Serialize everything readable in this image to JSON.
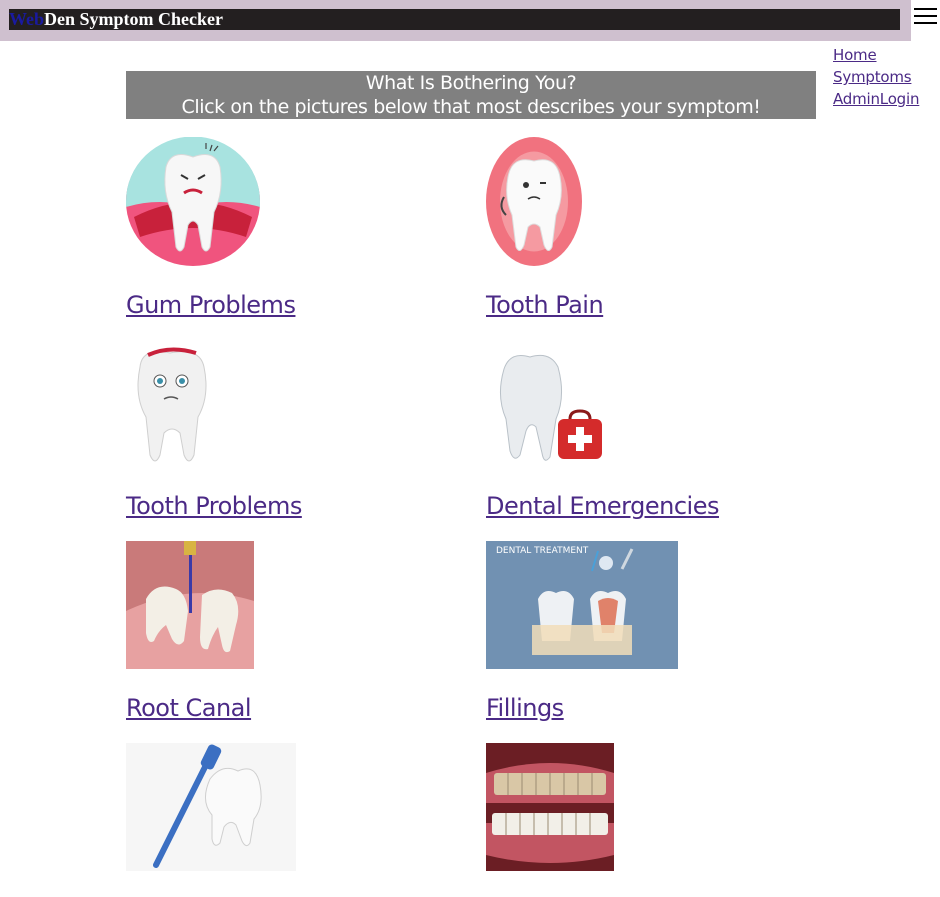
{
  "header": {
    "brand_web": "Web",
    "brand_rest": "Den Symptom Checker"
  },
  "nav": {
    "home": "Home",
    "symptoms": "Symptoms",
    "admin": "AdminLogin"
  },
  "banner": {
    "line1": "What Is Bothering You?",
    "line2": "Click on the pictures below that most describes your symptom!"
  },
  "items": [
    {
      "label": "Gum Problems"
    },
    {
      "label": "Tooth Pain"
    },
    {
      "label": "Tooth Problems"
    },
    {
      "label": "Dental Emergencies"
    },
    {
      "label": "Root Canal"
    },
    {
      "label": "Fillings"
    }
  ],
  "poster_title": "DENTAL TREATMENT",
  "colors": {
    "topbar": "#cfc0cf",
    "titlebar": "#231f20",
    "link": "#4b2a86",
    "banner": "#808080"
  }
}
